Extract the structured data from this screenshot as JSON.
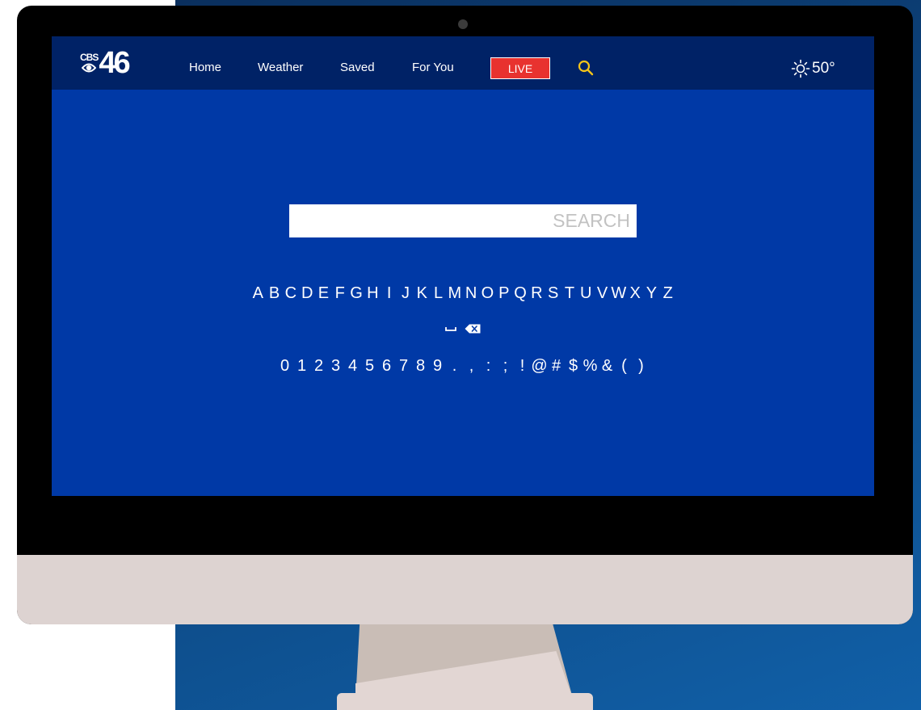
{
  "brand": {
    "logo_top": "CBS",
    "logo_number": "46"
  },
  "nav": {
    "items": [
      {
        "label": "Home"
      },
      {
        "label": "Weather"
      },
      {
        "label": "Saved"
      },
      {
        "label": "For You"
      }
    ],
    "live_label": "LIVE",
    "search_icon": "search-icon"
  },
  "weather": {
    "icon": "sun-icon",
    "temperature": "50°"
  },
  "search": {
    "placeholder": "SEARCH"
  },
  "keyboard": {
    "letters": [
      "A",
      "B",
      "C",
      "D",
      "E",
      "F",
      "G",
      "H",
      "I",
      "J",
      "K",
      "L",
      "M",
      "N",
      "O",
      "P",
      "Q",
      "R",
      "S",
      "T",
      "U",
      "V",
      "W",
      "X",
      "Y",
      "Z"
    ],
    "special_keys": [
      "space-key-icon",
      "backspace-key-icon"
    ],
    "symbols": [
      "0",
      "1",
      "2",
      "3",
      "4",
      "5",
      "6",
      "7",
      "8",
      "9",
      ".",
      ",",
      ":",
      ";",
      "!",
      "@",
      "#",
      "$",
      "%",
      "&",
      "(",
      ")"
    ]
  },
  "colors": {
    "screen_bg": "#0039a6",
    "navbar_bg": "#002266",
    "live_red": "#e8322f",
    "search_icon_yellow": "#f6c519",
    "backdrop_blue": "#0d4a86",
    "monitor_chin": "#ddd3d1"
  }
}
